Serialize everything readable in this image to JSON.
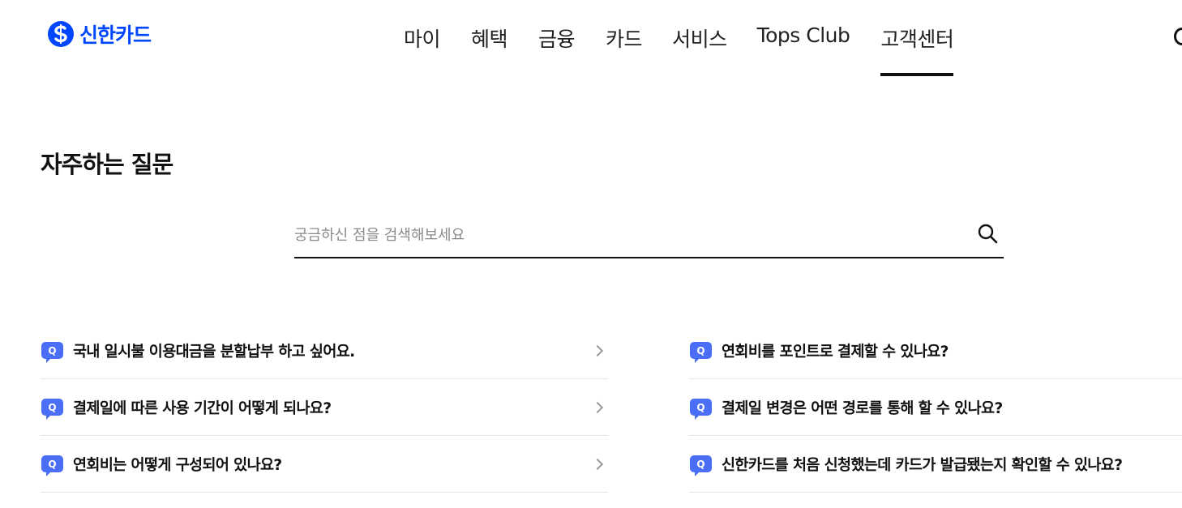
{
  "brand": {
    "name": "신한카드",
    "color": "#0046ff"
  },
  "nav": {
    "items": [
      {
        "label": "마이"
      },
      {
        "label": "혜택"
      },
      {
        "label": "금융"
      },
      {
        "label": "카드"
      },
      {
        "label": "서비스"
      },
      {
        "label": "Tops Club"
      },
      {
        "label": "고객센터"
      }
    ],
    "active": "고객센터",
    "utility_icon": "search-icon"
  },
  "page": {
    "title": "자주하는 질문"
  },
  "search": {
    "placeholder": "궁금하신 점을 검색해보세요",
    "value": "",
    "icon": "search-icon"
  },
  "faq": {
    "badge": "Q",
    "badge_color": "#4a6ef5",
    "left": [
      {
        "question": "국내 일시불 이용대금을 분할납부 하고 싶어요."
      },
      {
        "question": "결제일에 따른 사용 기간이 어떻게 되나요?"
      },
      {
        "question": "연회비는 어떻게 구성되어 있나요?"
      }
    ],
    "right": [
      {
        "question": "연회비를 포인트로 결제할 수 있나요?"
      },
      {
        "question": "결제일 변경은 어떤 경로를 통해 할 수 있나요?"
      },
      {
        "question": "신한카드를 처음 신청했는데 카드가 발급됐는지 확인할 수 있나요?"
      }
    ]
  }
}
